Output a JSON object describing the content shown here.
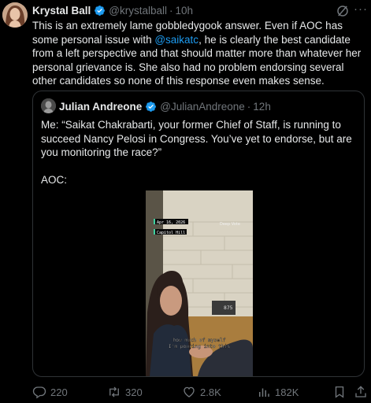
{
  "tweet": {
    "author_name": "Krystal Ball",
    "handle": "@krystalball",
    "time": "10h",
    "text_before_mention": "This is an extremely lame gobbledygook answer. Even if AOC has some personal issue with ",
    "mention": "@saikatc",
    "text_after_mention": ", he is clearly the best candidate from a left perspective and that should matter more than whatever her personal grievance is. She also had no problem endorsing several other candidates so none of this response even makes sense."
  },
  "quote": {
    "author_name": "Julian Andreone",
    "handle": "@JulianAndreone",
    "time": "12h",
    "paragraph1": "Me: “Saikat Chakrabarti, your former Chief of Staff, is running to succeed Nancy Pelosi in Congress. You’ve yet to endorse, but are you monitoring the race?”",
    "paragraph2": "AOC:",
    "video": {
      "overlay_date": "Apr 16, 2026",
      "overlay_location": "Capitol Hill",
      "overlay_watermark": "Deep Vote",
      "sign_number": "875",
      "caption_line1": "how much of myself",
      "caption_line2": "I'm pouring into this"
    }
  },
  "actions": {
    "replies": "220",
    "reposts": "320",
    "likes": "2.8K",
    "views": "182K"
  },
  "colors": {
    "accent": "#1d9bf0",
    "secondary_text": "#71767b",
    "border": "#2f3336"
  }
}
